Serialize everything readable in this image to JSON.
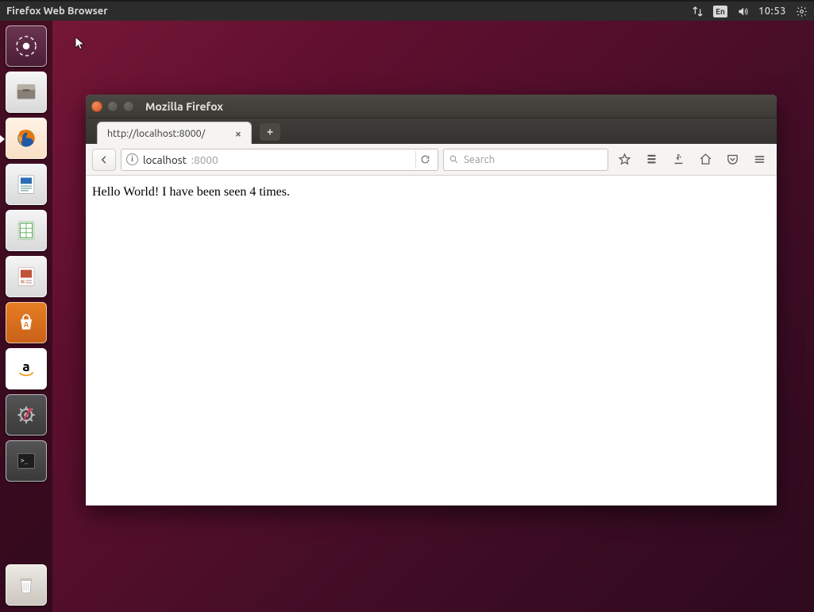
{
  "topbar": {
    "app_title": "Firefox Web Browser",
    "lang": "En",
    "clock": "10:53"
  },
  "launcher": {
    "items": [
      {
        "name": "dash",
        "label": "Dash"
      },
      {
        "name": "files",
        "label": "Files"
      },
      {
        "name": "firefox",
        "label": "Firefox"
      },
      {
        "name": "writer",
        "label": "LibreOffice Writer"
      },
      {
        "name": "calc",
        "label": "LibreOffice Calc"
      },
      {
        "name": "impress",
        "label": "LibreOffice Impress"
      },
      {
        "name": "software",
        "label": "Ubuntu Software"
      },
      {
        "name": "amazon",
        "label": "Amazon"
      },
      {
        "name": "settings",
        "label": "System Settings"
      },
      {
        "name": "terminal",
        "label": "Terminal"
      }
    ],
    "trash": {
      "label": "Trash"
    }
  },
  "window": {
    "title": "Mozilla Firefox",
    "tab_label": "http://localhost:8000/",
    "url_host": "localhost",
    "url_port": ":8000",
    "search_placeholder": "Search",
    "page_text": "Hello World! I have been seen 4 times."
  }
}
